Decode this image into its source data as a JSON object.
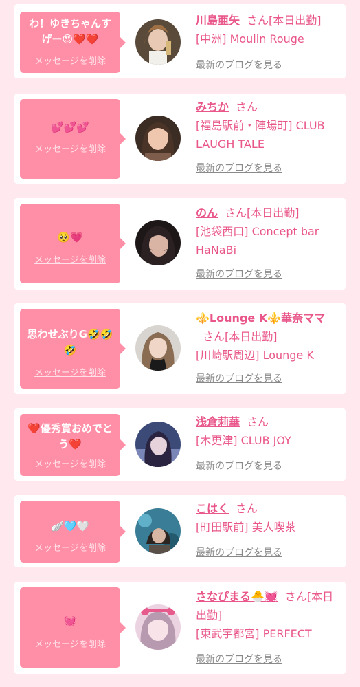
{
  "delete_label": "メッセージを削除",
  "blog_label": "最新のブログを見る",
  "colors": {
    "accent": "#e9568a",
    "bubble": "#ff8fa7",
    "background": "#ffe9ee"
  },
  "entries": [
    {
      "message": "わ！ゆきちゃんすげー😍❤️❤️",
      "name": "川島亜矢",
      "suffix": "さん[本日出勤]",
      "shop": "[中洲] Moulin Rouge"
    },
    {
      "message": "💕💕💕",
      "name": "みちか",
      "suffix": "さん",
      "shop": "[福島駅前・陣場町] CLUB LAUGH TALE"
    },
    {
      "message": "🥺💗",
      "name": "のん",
      "suffix": "さん[本日出勤]",
      "shop": "[池袋西口] Concept bar HaNaBi"
    },
    {
      "message": "思わせぶりG🤣🤣🤣",
      "name": "⚜️Lounge K⚜️華奈ママ",
      "suffix": "さん[本日出勤]",
      "shop": "[川崎駅周辺] Lounge K"
    },
    {
      "message": "❤️優秀賞おめでとう❤️",
      "name": "浅倉莉華",
      "suffix": "さん",
      "shop": "[木更津] CLUB JOY"
    },
    {
      "message": "🪽🩵🤍",
      "name": "こはく",
      "suffix": "さん",
      "shop": "[町田駅前] 美人喫茶"
    },
    {
      "message": "💓",
      "name": "さなぴまる🐣💓",
      "suffix": "さん[本日出勤]",
      "shop": "[東武宇都宮] PERFECT"
    }
  ]
}
